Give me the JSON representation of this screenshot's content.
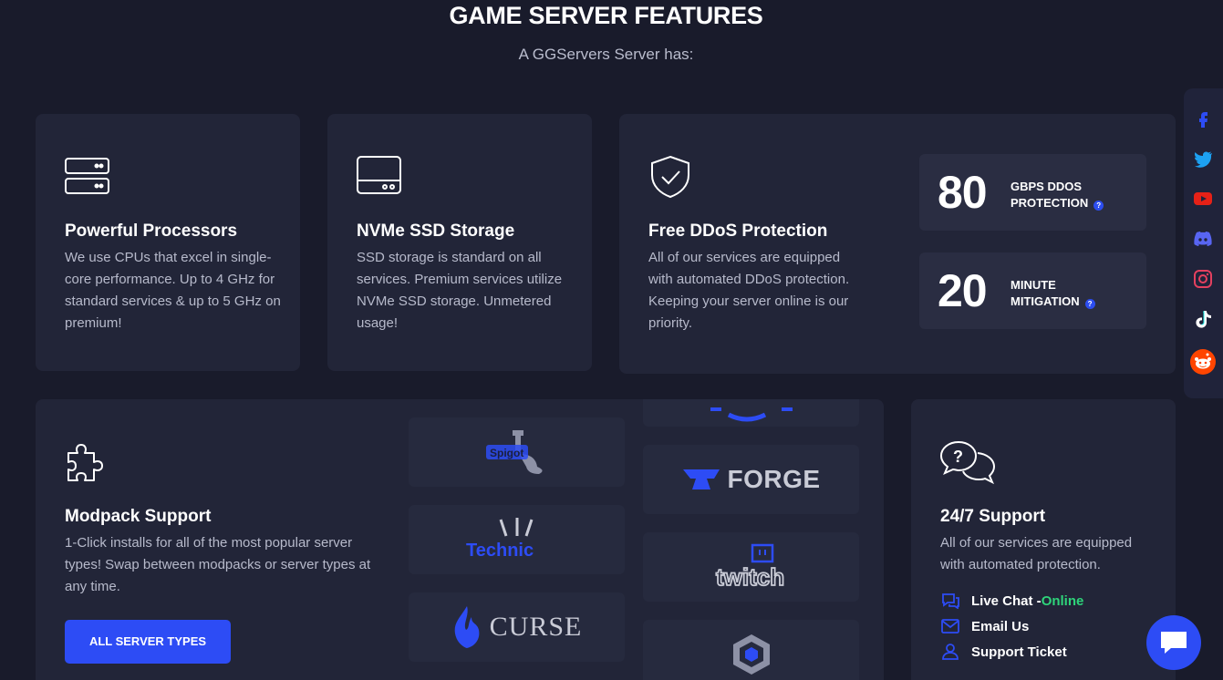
{
  "header": {
    "title": "GAME SERVER FEATURES",
    "subtitle": "A GGServers Server has:"
  },
  "features": {
    "processors": {
      "icon": "server-icon",
      "title": "Powerful Processors",
      "description": "We use CPUs that excel in single-core performance. Up to 4 GHz for standard services & up to 5 GHz on premium!"
    },
    "storage": {
      "icon": "drive-icon",
      "title": "NVMe SSD Storage",
      "description": "SSD storage is standard on all services. Premium services utilize NVMe SSD storage. Unmetered usage!"
    },
    "ddos": {
      "icon": "shield-check-icon",
      "title": "Free DDoS Protection",
      "description": "All of our services are equipped with automated DDoS protection. Keeping your server online is our priority.",
      "stats": [
        {
          "number": "80",
          "label_line1": "GBPS DDOS",
          "label_line2": "PROTECTION"
        },
        {
          "number": "20",
          "label_line1": "MINUTE",
          "label_line2": "MITIGATION"
        }
      ]
    },
    "modpack": {
      "icon": "puzzle-icon",
      "title": "Modpack Support",
      "description": "1-Click installs for all of the most popular server types! Swap between modpacks or server types at any time.",
      "button_label": "ALL SERVER TYPES",
      "logos": {
        "spigot": "Spigot",
        "forge": "FORGE",
        "technic": "Technic",
        "twitch": "twitch",
        "curse": "CURSE"
      }
    },
    "support": {
      "icon": "chat-question-icon",
      "title": "24/7 Support",
      "description": "All of our services are equipped with automated protection.",
      "live_chat": "Live Chat - ",
      "live_status": "Online",
      "email": "Email Us",
      "ticket": "Support Ticket"
    }
  },
  "social": [
    "facebook-icon",
    "twitter-icon",
    "youtube-icon",
    "discord-icon",
    "instagram-icon",
    "tiktok-icon",
    "reddit-icon"
  ],
  "colors": {
    "background": "#191b2b",
    "card": "#222538",
    "accent": "#2d4cf5",
    "online": "#2ed47a"
  }
}
